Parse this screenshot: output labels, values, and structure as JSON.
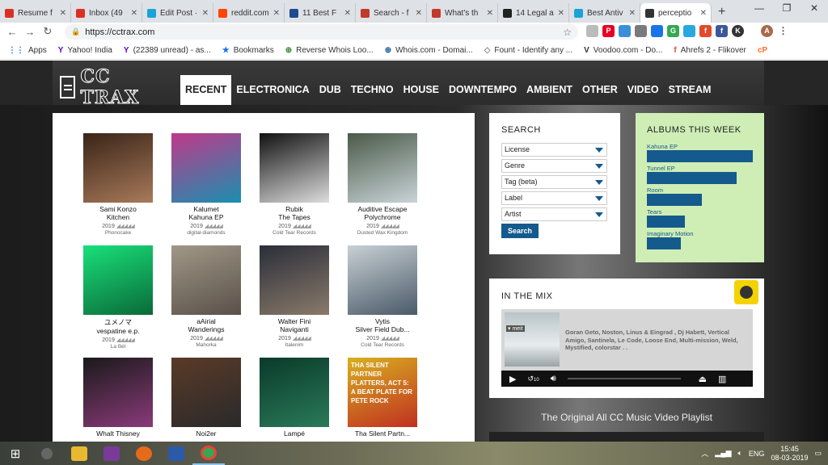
{
  "browser": {
    "tabs": [
      {
        "label": "Resume f",
        "color": "#d93025"
      },
      {
        "label": "Inbox (49",
        "color": "#d93025"
      },
      {
        "label": "Edit Post ·",
        "color": "#1aa3d9"
      },
      {
        "label": "reddit.com",
        "color": "#ff4500"
      },
      {
        "label": "11 Best F",
        "color": "#1e4b8f"
      },
      {
        "label": "Search - f",
        "color": "#c0392b"
      },
      {
        "label": "What's th",
        "color": "#c0392b"
      },
      {
        "label": "14 Legal a",
        "color": "#222222"
      },
      {
        "label": "Best Antiv",
        "color": "#1aa3d9"
      },
      {
        "label": "perceptio",
        "color": "#333333",
        "active": true
      }
    ],
    "new_tab": "+",
    "url": "https://cctrax.com",
    "bookmarks": [
      {
        "label": "Apps",
        "icon": "apps-grid-icon"
      },
      {
        "label": "Yahoo! India",
        "icon": "yahoo-icon"
      },
      {
        "label": "(22389 unread) - as...",
        "icon": "yahoo-mail-icon"
      },
      {
        "label": "Bookmarks",
        "icon": "star-icon"
      },
      {
        "label": "Reverse Whois Loo...",
        "icon": "whois-icon"
      },
      {
        "label": "Whois.com - Domai...",
        "icon": "whois-com-icon"
      },
      {
        "label": "Fount - Identify any ...",
        "icon": "fount-icon"
      },
      {
        "label": "Voodoo.com - Do...",
        "icon": "voodoo-icon"
      },
      {
        "label": "Ahrefs 2 - Flikover",
        "icon": "ahrefs-icon"
      },
      {
        "label": "cP",
        "icon": "cpanel-icon"
      }
    ]
  },
  "site": {
    "logo": "CC TRAX",
    "nav": [
      "RECENT",
      "ELECTRONICA",
      "DUB",
      "TECHNO",
      "HOUSE",
      "DOWNTEMPO",
      "AMBIENT",
      "OTHER",
      "VIDEO",
      "STREAM"
    ],
    "albums": [
      {
        "artist": "Sami Konzo",
        "title": "Kitchen",
        "year": "2019",
        "label": "Phonocake",
        "c1": "#3a2418",
        "c2": "#a87a5a"
      },
      {
        "artist": "Kalumet",
        "title": "Kahuna EP",
        "year": "2019",
        "label": "digital-diamonds",
        "c1": "#c0398a",
        "c2": "#1a8fb0"
      },
      {
        "artist": "Rubik",
        "title": "The Tapes",
        "year": "2019",
        "label": "Cold Tear Records",
        "c1": "#111111",
        "c2": "#dddddd"
      },
      {
        "artist": "Auditive Escape",
        "title": "Polychrome",
        "year": "2019",
        "label": "Dusted Wax Kingdom",
        "c1": "#4a5a48",
        "c2": "#c8d4d8"
      },
      {
        "artist": "ユメノマ",
        "title": "vespatine e.p.",
        "year": "2019",
        "label": "La Bél",
        "c1": "#19e07a",
        "c2": "#0a6a38"
      },
      {
        "artist": "aAirial",
        "title": "Wanderings",
        "year": "2019",
        "label": "Mahorka",
        "c1": "#a09888",
        "c2": "#5a5048"
      },
      {
        "artist": "Walter Fini",
        "title": "Naviganti",
        "year": "2019",
        "label": "Italenim",
        "c1": "#2a2e3a",
        "c2": "#8a7a6a"
      },
      {
        "artist": "Vytis",
        "title": "Silver Field Dub...",
        "year": "2019",
        "label": "Cold Tear Records",
        "c1": "#c8d0d4",
        "c2": "#4a5a68"
      },
      {
        "artist": "Whalt Thisney",
        "title": "",
        "year": "",
        "label": "",
        "c1": "#1a1a1a",
        "c2": "#8a3a7a"
      },
      {
        "artist": "Noi2er",
        "title": "",
        "year": "",
        "label": "",
        "c1": "#5a3a28",
        "c2": "#2a2a2a"
      },
      {
        "artist": "Lampé",
        "title": "",
        "year": "",
        "label": "",
        "c1": "#0a3a2a",
        "c2": "#2a7a5a"
      },
      {
        "artist": "Tha Silent Partn...",
        "title": "",
        "year": "",
        "label": "",
        "c1": "#d8b020",
        "c2": "#c03020",
        "cover_text": "THA SILENT PARTNER PLATTERS, ACT 5: A BEAT PLATE FOR PETE ROCK"
      }
    ],
    "search": {
      "title": "SEARCH",
      "selects": [
        "License",
        "Genre",
        "Tag (beta)",
        "Label",
        "Artist"
      ],
      "button": "Search"
    },
    "albums_this_week": {
      "title": "ALBUMS THIS WEEK",
      "items": [
        {
          "label": "Kahuna EP",
          "value": 1.0
        },
        {
          "label": "Tunnel EP",
          "value": 0.85
        },
        {
          "label": "Room",
          "value": 0.52
        },
        {
          "label": "Tears",
          "value": 0.36
        },
        {
          "label": "Imaginary Motion",
          "value": 0.32
        }
      ]
    },
    "in_the_mix": {
      "title": "IN THE MIX",
      "thumb_tag": "▾ meit",
      "description": "Goran Geto, Noston, Linus & Eingrad , Dj Habett, Vertical Amigo, Santinela, Le Code, Loose End, Multi-mission, Weld, Mystified, colorstar . .",
      "skip": "10"
    },
    "playlist_title": "The Original All CC Music Video Playlist"
  },
  "taskbar": {
    "lang": "ENG",
    "time": "15:45",
    "date": "08-03-2019"
  }
}
